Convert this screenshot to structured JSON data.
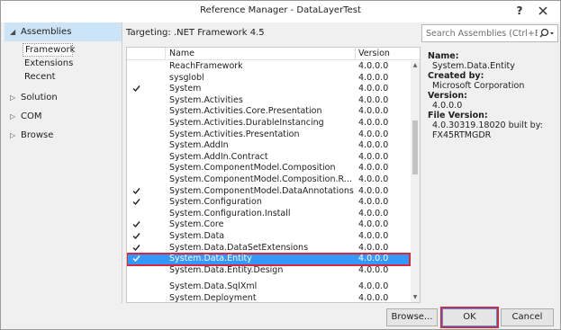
{
  "window": {
    "title": "Reference Manager - DataLayerTest",
    "help_label": "?"
  },
  "nav": {
    "groups": [
      {
        "label": "Assemblies",
        "expanded": true,
        "selected": true
      },
      {
        "label": "Solution",
        "expanded": false
      },
      {
        "label": "COM",
        "expanded": false
      },
      {
        "label": "Browse",
        "expanded": false
      }
    ],
    "assemblies_sub": [
      "Framework",
      "Extensions",
      "Recent"
    ],
    "expanded_arrow": "◢",
    "collapsed_arrow": "▷"
  },
  "header": {
    "targeting": "Targeting: .NET Framework 4.5"
  },
  "search": {
    "placeholder": "Search Assemblies (Ctrl+E)"
  },
  "list": {
    "columns": [
      "Name",
      "Version"
    ],
    "rows": [
      {
        "name": "ReachFramework",
        "version": "4.0.0.0",
        "checked": false
      },
      {
        "name": "sysglobl",
        "version": "4.0.0.0",
        "checked": false
      },
      {
        "name": "System",
        "version": "4.0.0.0",
        "checked": true
      },
      {
        "name": "System.Activities",
        "version": "4.0.0.0",
        "checked": false
      },
      {
        "name": "System.Activities.Core.Presentation",
        "version": "4.0.0.0",
        "checked": false
      },
      {
        "name": "System.Activities.DurableInstancing",
        "version": "4.0.0.0",
        "checked": false
      },
      {
        "name": "System.Activities.Presentation",
        "version": "4.0.0.0",
        "checked": false
      },
      {
        "name": "System.AddIn",
        "version": "4.0.0.0",
        "checked": false
      },
      {
        "name": "System.AddIn.Contract",
        "version": "4.0.0.0",
        "checked": false
      },
      {
        "name": "System.ComponentModel.Composition",
        "version": "4.0.0.0",
        "checked": false
      },
      {
        "name": "System.ComponentModel.Composition.Regist...",
        "version": "4.0.0.0",
        "checked": false
      },
      {
        "name": "System.ComponentModel.DataAnnotations",
        "version": "4.0.0.0",
        "checked": true
      },
      {
        "name": "System.Configuration",
        "version": "4.0.0.0",
        "checked": true
      },
      {
        "name": "System.Configuration.Install",
        "version": "4.0.0.0",
        "checked": false
      },
      {
        "name": "System.Core",
        "version": "4.0.0.0",
        "checked": true
      },
      {
        "name": "System.Data",
        "version": "4.0.0.0",
        "checked": true
      },
      {
        "name": "System.Data.DataSetExtensions",
        "version": "4.0.0.0",
        "checked": true
      },
      {
        "name": "System.Data.Entity",
        "version": "4.0.0.0",
        "checked": true,
        "selected": true
      },
      {
        "name": "System.Data.Entity.Design",
        "version": "4.0.0.0",
        "checked": false
      },
      {
        "name": "",
        "version": "",
        "checked": false,
        "partial": true
      },
      {
        "name": "System.Data.SqlXml",
        "version": "4.0.0.0",
        "checked": false
      },
      {
        "name": "System.Deployment",
        "version": "4.0.0.0",
        "checked": false
      }
    ]
  },
  "details": {
    "name_label": "Name:",
    "name_value": "System.Data.Entity",
    "created_by_label": "Created by:",
    "created_by_value": "Microsoft Corporation",
    "version_label": "Version:",
    "version_value": "4.0.0.0",
    "file_version_label": "File Version:",
    "file_version_value_1": "4.0.30319.18020 built by:",
    "file_version_value_2": "FX45RTMGDR"
  },
  "buttons": {
    "browse": "Browse...",
    "ok": "OK",
    "cancel": "Cancel"
  },
  "colors": {
    "selection": "#3399ff",
    "highlight_outline": "#d8283c",
    "nav_selected": "#cce4f7"
  }
}
